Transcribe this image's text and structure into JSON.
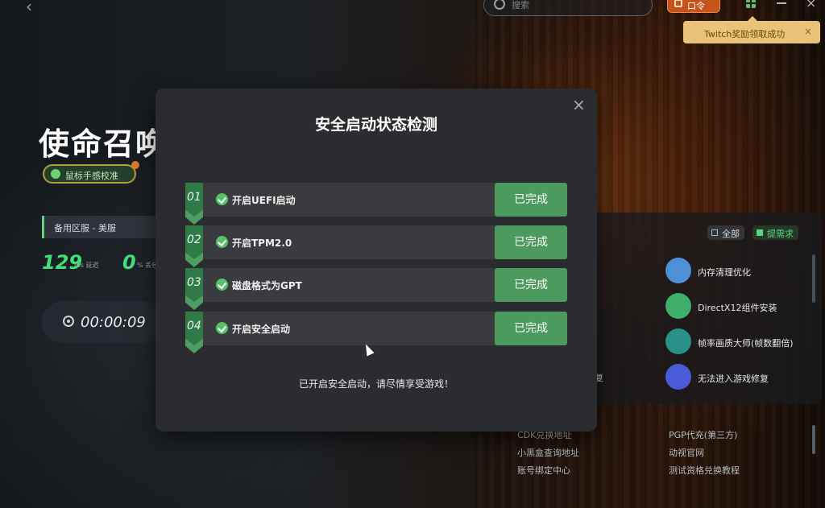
{
  "topbar": {
    "search_placeholder": "搜索",
    "code_button": "口令",
    "toast_text": "Twitch奖励领取成功",
    "toast_close": "×"
  },
  "game": {
    "title": "使命召唤",
    "mouse_badge": "鼠标手感校准",
    "server": "备用区服 - 美服",
    "latency_value": "129",
    "latency_unit": "ms 延迟",
    "loss_value": "0",
    "loss_unit": "% 丢包",
    "timer": "00:00:09"
  },
  "tools": {
    "filter_all": "全部",
    "filter_request": "提需求",
    "partial_text": "复",
    "items": [
      {
        "label": "内存清理优化",
        "icon": "memory-clean-icon",
        "color": "#4f8fd8"
      },
      {
        "label": "DirectX12组件安装",
        "icon": "directx-icon",
        "color": "#3fae6a"
      },
      {
        "label": "帧率画质大师(帧数翻倍)",
        "icon": "fps-master-icon",
        "color": "#2b8f8a"
      },
      {
        "label": "无法进入游戏修复",
        "icon": "repair-icon",
        "color": "#4a5bd8"
      }
    ],
    "links": [
      "CDK兑换地址",
      "PGP代充(第三方)",
      "小黑盒查询地址",
      "动视官网",
      "账号绑定中心",
      "测试资格兑换教程"
    ]
  },
  "modal": {
    "title": "安全启动状态检测",
    "close": "×",
    "steps": [
      {
        "num": "01",
        "label": "开启UEFI启动",
        "status": "已完成"
      },
      {
        "num": "02",
        "label": "开启TPM2.0",
        "status": "已完成"
      },
      {
        "num": "03",
        "label": "磁盘格式为GPT",
        "status": "已完成"
      },
      {
        "num": "04",
        "label": "开启安全启动",
        "status": "已完成"
      }
    ],
    "footer": "已开启安全启动，请尽情享受游戏！"
  },
  "colors": {
    "accent_green": "#4c9a5e",
    "toast_bg": "#e9c37a",
    "code_button_bg": "#c6521c"
  }
}
